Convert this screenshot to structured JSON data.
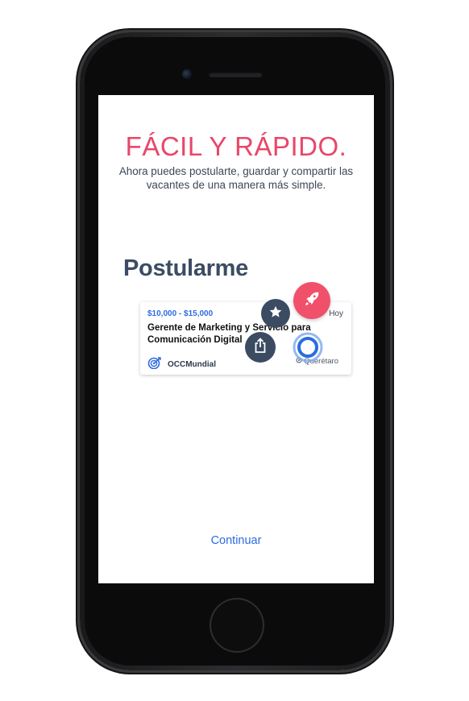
{
  "screen": {
    "headline": "FÁCIL Y RÁPIDO.",
    "subtitle": "Ahora puedes postularte, guardar y compartir las vacantes de una manera más simple.",
    "section_title": "Postularme",
    "continue_label": "Continuar"
  },
  "job_card": {
    "salary": "$10,000 - $15,000",
    "date": "Hoy",
    "title": "Gerente de Marketing y Servicio para Comunicación Digital",
    "brand": "OCCMundial",
    "location": "Querétaro"
  },
  "icons": {
    "save": "star-icon",
    "apply": "rocket-icon",
    "share": "share-icon",
    "touch": "touch-indicator-icon",
    "brand": "occ-target-icon",
    "location": "location-pin-icon"
  },
  "colors": {
    "accent": "#e8476a",
    "link": "#2b6cdf",
    "dark_fab": "#3a4b62",
    "title": "#3b4c63"
  }
}
